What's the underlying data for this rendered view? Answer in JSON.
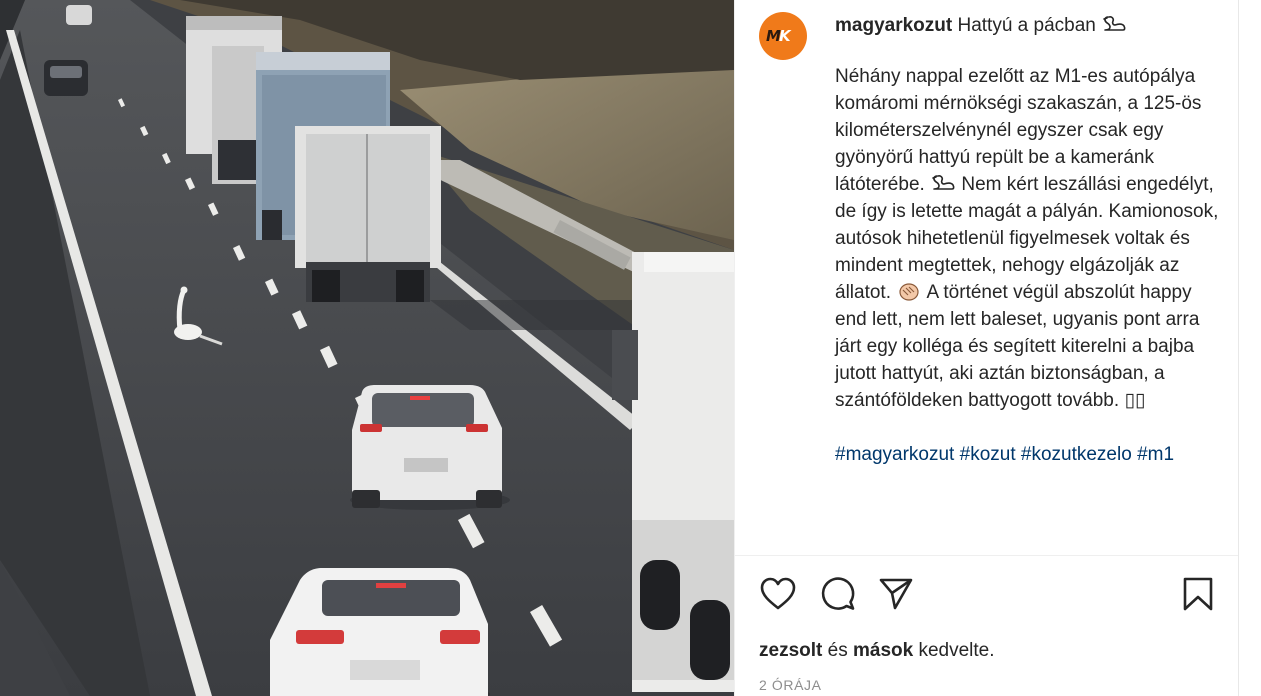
{
  "post": {
    "username": "magyarkozut",
    "title": "Hattyú a pácban",
    "avatar_logo_text": "MK",
    "body_part1": "Néhány nappal ezelőtt az M1-es autópálya komáromi mérnökségi szakaszán, a 125-ös kilométerszelvénynél egyszer csak egy gyönyörű hattyú repült be a kameránk látóterébe.",
    "body_part2": "Nem kért leszállási engedélyt, de így is letette magát a pályán. Kamionosok, autósok hihetetlenül figyelmesek voltak és mindent megtettek, nehogy elgázolják az állatot.",
    "body_part3": "A történet végül abszolút happy end lett, nem lett baleset, ugyanis pont arra járt egy kolléga és segített kiterelni a bajba jutott hattyút, aki aztán biztonságban, a szántóföldeken battyogott tovább.",
    "trailing_glyphs": "▯▯",
    "hashtags": [
      "#magyarkozut",
      "#kozut",
      "#kozutkezelo",
      "#m1"
    ],
    "likes_user": "zezsolt",
    "likes_and": "és",
    "likes_others": "mások",
    "likes_suffix": "kedvelte.",
    "timestamp": "2 ÓRÁJA"
  },
  "icons": {
    "swan": "swan-icon",
    "clap": "clapping-hands-icon",
    "like": "heart-icon",
    "comment": "comment-icon",
    "share": "share-icon",
    "save": "bookmark-icon"
  },
  "colors": {
    "avatar_bg": "#f07a1a",
    "hashtag": "#00376b",
    "meta_gray": "#8e8e8e"
  }
}
